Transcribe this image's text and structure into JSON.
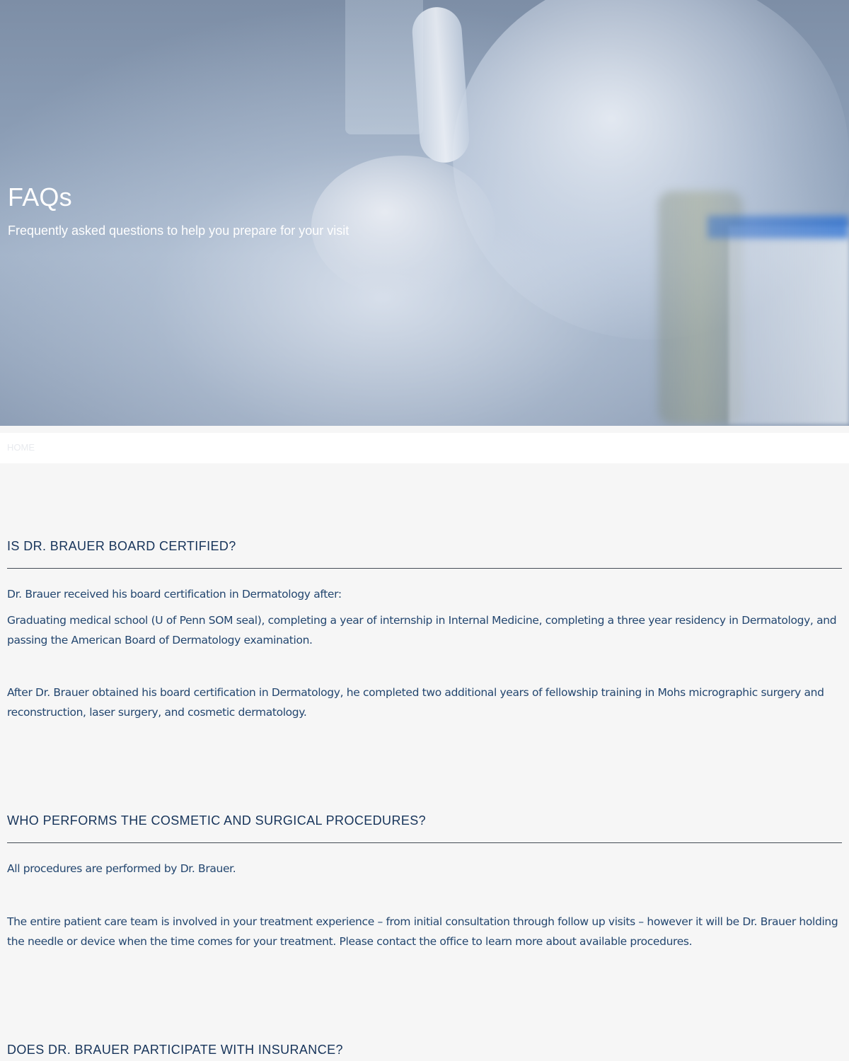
{
  "hero": {
    "title": "FAQs",
    "subtitle": "Frequently asked questions to help you prepare for your visit"
  },
  "breadcrumb": {
    "home": "HOME"
  },
  "faqs": [
    {
      "question": "IS DR. BRAUER BOARD CERTIFIED?",
      "answers": [
        "Dr. Brauer received his board certification in Dermatology after:",
        "Graduating medical school (U of Penn SOM seal), completing a year of internship in Internal Medicine, completing a three year residency in Dermatology, and passing the American Board of Dermatology examination.",
        "After Dr. Brauer obtained his board certification in Dermatology, he completed two additional years of fellowship training in Mohs micrographic surgery and reconstruction, laser surgery, and cosmetic dermatology."
      ]
    },
    {
      "question": "WHO PERFORMS THE COSMETIC AND SURGICAL PROCEDURES?",
      "answers": [
        "All procedures are performed by Dr. Brauer.",
        "The entire patient care team is involved in your treatment experience – from initial consultation through follow up visits – however it will be Dr. Brauer holding the needle or device when the time comes for your treatment. Please contact the office to learn more about available procedures."
      ]
    },
    {
      "question": "DOES DR. BRAUER PARTICIPATE WITH INSURANCE?"
    }
  ]
}
